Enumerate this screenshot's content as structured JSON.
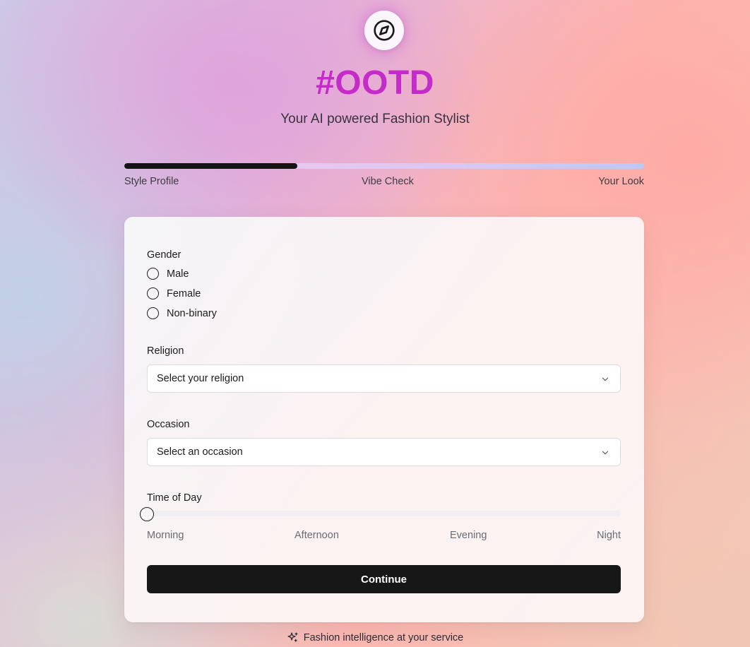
{
  "header": {
    "logo_icon": "compass-icon",
    "title": "#OOTD",
    "subtitle": "Your AI powered Fashion Stylist"
  },
  "progress": {
    "value": 0.333,
    "steps": [
      "Style Profile",
      "Vibe Check",
      "Your Look"
    ]
  },
  "form": {
    "gender": {
      "label": "Gender",
      "options": [
        "Male",
        "Female",
        "Non-binary"
      ]
    },
    "religion": {
      "label": "Religion",
      "placeholder": "Select your religion"
    },
    "occasion": {
      "label": "Occasion",
      "placeholder": "Select an occasion"
    },
    "time_of_day": {
      "label": "Time of Day",
      "options": [
        "Morning",
        "Afternoon",
        "Evening",
        "Night"
      ],
      "selected_index": 0
    },
    "continue_label": "Continue"
  },
  "footer": {
    "icon": "sparkles-icon",
    "text": "Fashion intelligence at your service"
  },
  "colors": {
    "accent": "#c42bc8",
    "button": "#171717"
  }
}
